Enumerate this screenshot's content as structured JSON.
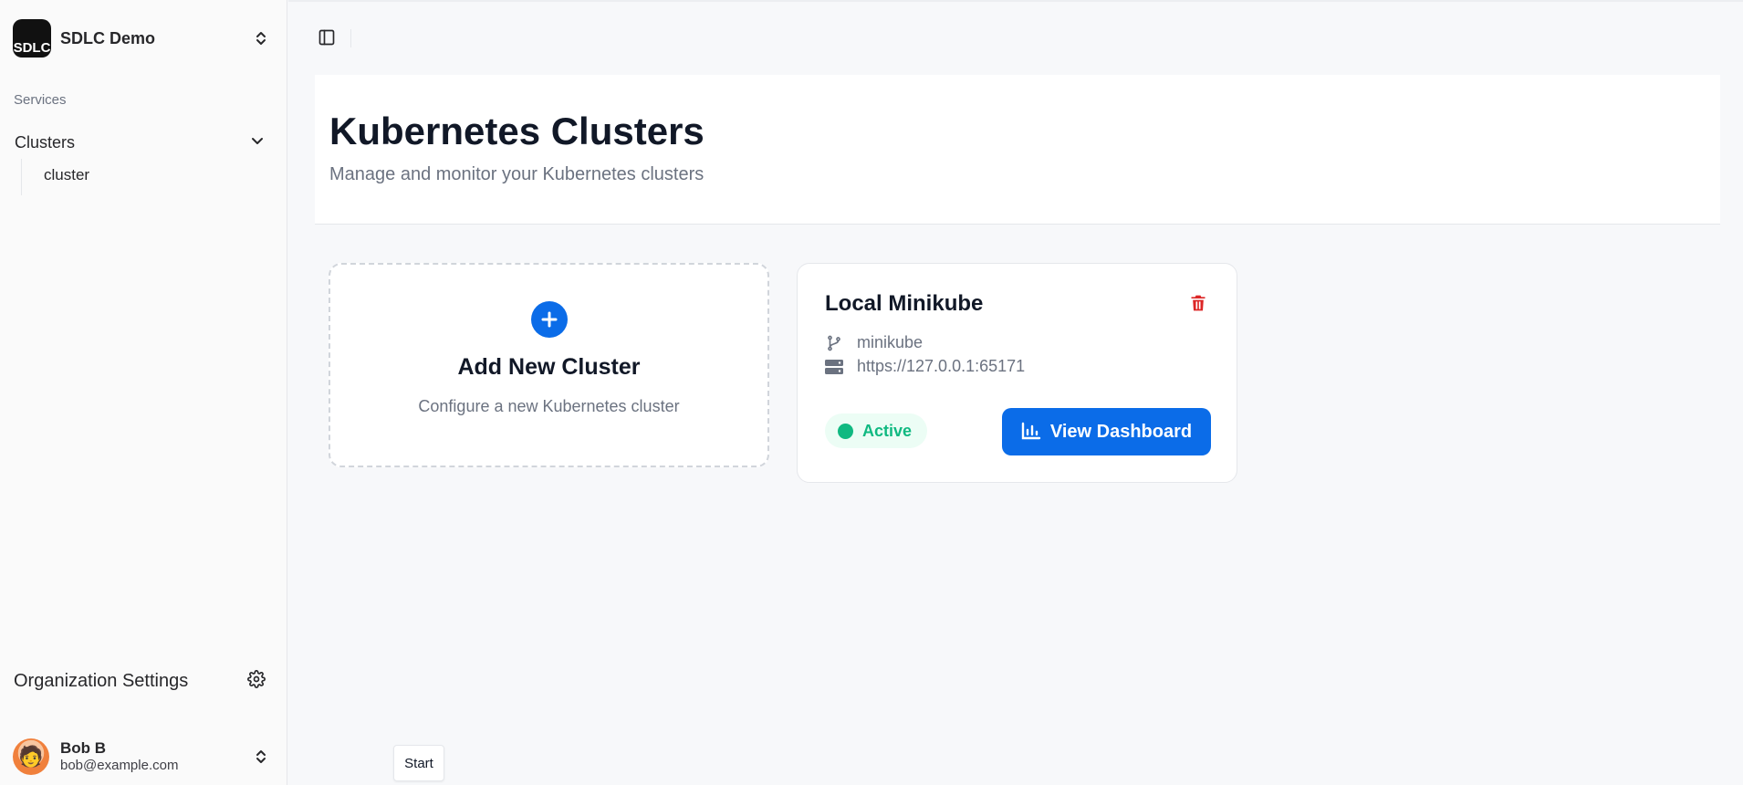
{
  "sidebar": {
    "org_name": "SDLC Demo",
    "org_logo_text": "SDLC",
    "section_label": "Services",
    "nav_group_label": "Clusters",
    "sub_items": [
      {
        "label": "cluster"
      }
    ],
    "org_settings_label": "Organization Settings",
    "user": {
      "name": "Bob B",
      "email": "bob@example.com"
    }
  },
  "header": {
    "title": "Kubernetes Clusters",
    "subtitle": "Manage and monitor your Kubernetes clusters"
  },
  "add_card": {
    "title": "Add New Cluster",
    "description": "Configure a new Kubernetes cluster"
  },
  "cluster_card": {
    "name": "Local Minikube",
    "context": "minikube",
    "server": "https://127.0.0.1:65171",
    "status": "Active",
    "dashboard_label": "View Dashboard"
  },
  "tooltip": {
    "text": "Start"
  },
  "colors": {
    "primary": "#0b6ce8",
    "danger": "#dc2626",
    "success": "#10b981",
    "success_bg": "#ecfdf5"
  },
  "icons": {
    "org_switcher": "chevrons-up-down-icon",
    "group_toggle": "chevron-down-icon",
    "settings": "gear-icon",
    "sidebar_toggle": "panel-left-icon",
    "add": "plus-circle-icon",
    "delete": "trash-icon",
    "context": "git-branch-icon",
    "server": "server-icon",
    "dashboard": "bar-chart-icon"
  }
}
